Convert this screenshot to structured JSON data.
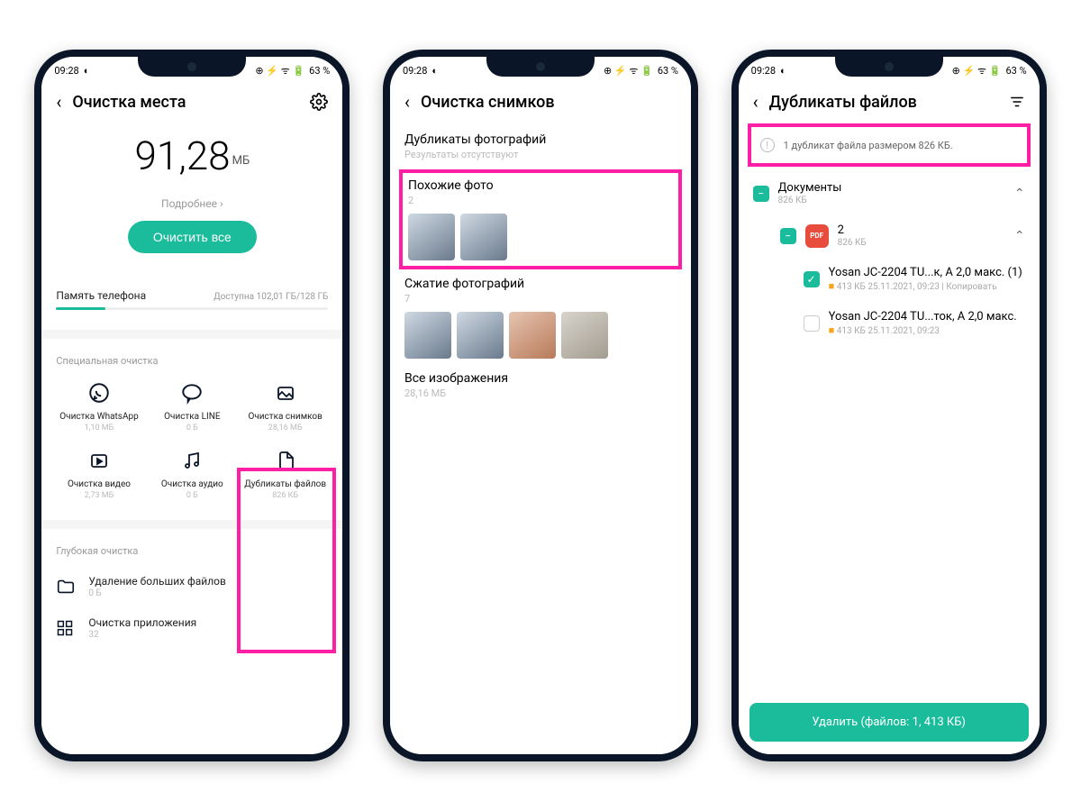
{
  "statusbar": {
    "time": "09:28",
    "battery": "63 %"
  },
  "phone1": {
    "title": "Очистка места",
    "storage_value": "91,28",
    "storage_unit": "МБ",
    "more": "Подробнее ›",
    "clean_all": "Очистить все",
    "phone_memory": "Память телефона",
    "available": "Доступна 102,01 ГБ/128 ГБ",
    "special_label": "Специальная очистка",
    "grid": [
      {
        "label": "Очистка WhatsApp",
        "sub": "1,10 МБ"
      },
      {
        "label": "Очистка LINE",
        "sub": "0 Б"
      },
      {
        "label": "Очистка снимков",
        "sub": "28,16 МБ"
      },
      {
        "label": "Очистка видео",
        "sub": "2,73 МБ"
      },
      {
        "label": "Очистка аудио",
        "sub": "0 Б"
      },
      {
        "label": "Дубликаты файлов",
        "sub": "826 КБ"
      }
    ],
    "deep_label": "Глубокая очистка",
    "deep_rows": [
      {
        "label": "Удаление больших файлов",
        "sub": "0 Б"
      },
      {
        "label": "Очистка приложения",
        "sub": "32"
      }
    ]
  },
  "phone2": {
    "title": "Очистка снимков",
    "sec_dup": "Дубликаты фотографий",
    "sec_dup_sub": "Результаты отсутствуют",
    "sec_similar": "Похожие фото",
    "sec_similar_sub": "2",
    "sec_compress": "Сжатие фотографий",
    "sec_compress_sub": "7",
    "sec_all": "Все изображения",
    "sec_all_sub": "28,16 МБ"
  },
  "phone3": {
    "title": "Дубликаты файлов",
    "info": "1 дубликат файла размером 826 КБ.",
    "root": {
      "name": "Документы",
      "size": "826 КБ"
    },
    "group": {
      "name": "2",
      "size": "826 КБ"
    },
    "files": [
      {
        "name": "Yosan JC-2204 TU...к, А 2,0 макс. (1)",
        "meta": "413 КБ 25.11.2021, 09:23  |  Копировать",
        "checked": true
      },
      {
        "name": "Yosan JC-2204 TU...ток, А 2,0 макс.",
        "meta": "413 КБ 25.11.2021, 09:23",
        "checked": false
      }
    ],
    "delete_btn": "Удалить (файлов: 1, 413 КБ)"
  }
}
